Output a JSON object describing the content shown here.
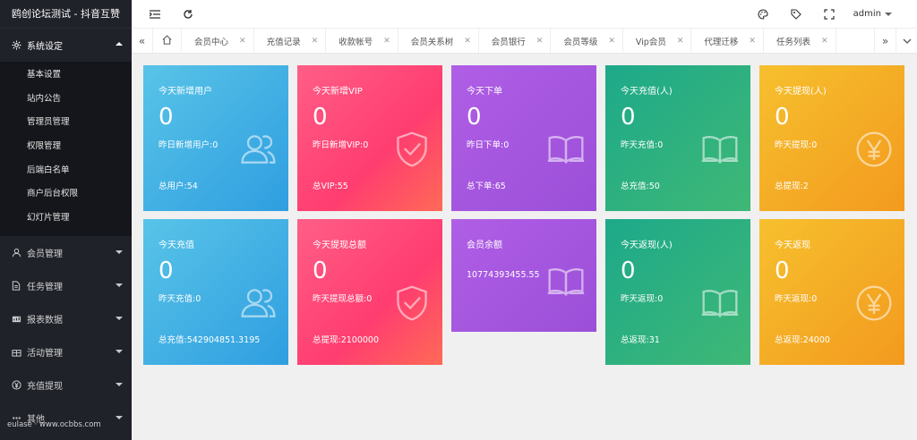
{
  "app": {
    "title": "鸥创论坛测试 - 抖音互赞"
  },
  "header": {
    "user": "admin"
  },
  "sidebar": {
    "groups": [
      {
        "label": "系统设定",
        "icon": "gear-icon",
        "open": true,
        "items": [
          "基本设置",
          "站内公告",
          "管理员管理",
          "权限管理",
          "后端白名单",
          "商户后台权限",
          "幻灯片管理"
        ]
      },
      {
        "label": "会员管理",
        "icon": "user-icon"
      },
      {
        "label": "任务管理",
        "icon": "document-icon"
      },
      {
        "label": "报表数据",
        "icon": "chart-icon"
      },
      {
        "label": "活动管理",
        "icon": "gift-icon"
      },
      {
        "label": "充值提现",
        "icon": "yen-icon"
      },
      {
        "label": "其他",
        "icon": "more-icon"
      }
    ],
    "watermark": "eulase · www.ocbbs.com"
  },
  "tabs": {
    "items": [
      "会员中心",
      "充值记录",
      "收款帐号",
      "会员关系树",
      "会员银行",
      "会员等级",
      "Vip会员",
      "代理迁移",
      "任务列表"
    ]
  },
  "cards": [
    {
      "color": "blue",
      "icon": "users-icon",
      "title": "今天新增用户",
      "value": "0",
      "line": "昨日新增用户:0",
      "foot": "总用户:54"
    },
    {
      "color": "pink",
      "icon": "shield-icon",
      "title": "今天新增VIP",
      "value": "0",
      "line": "昨日新增VIP:0",
      "foot": "总VIP:55"
    },
    {
      "color": "purple",
      "icon": "book-icon",
      "title": "今天下单",
      "value": "0",
      "line": "昨日下单:0",
      "foot": "总下单:65"
    },
    {
      "color": "green",
      "icon": "book-icon",
      "title": "今天充值(人)",
      "value": "0",
      "line": "昨天充值:0",
      "foot": "总充值:50"
    },
    {
      "color": "orange",
      "icon": "yen-icon",
      "title": "今天提现(人)",
      "value": "0",
      "line": "昨天提现:0",
      "foot": "总提现:2"
    },
    {
      "color": "blue",
      "icon": "users-icon",
      "title": "今天充值",
      "value": "0",
      "line": "昨天充值:0",
      "foot": "总充值:542904851.3195"
    },
    {
      "color": "pink",
      "icon": "shield-icon",
      "title": "今天提现总额",
      "value": "0",
      "line": "昨天提现总额:0",
      "foot": "总提现:2100000"
    },
    {
      "color": "purple",
      "icon": "book-icon",
      "title": "会员余额",
      "value": "",
      "line": "10774393455.55",
      "foot": ""
    },
    {
      "color": "green",
      "icon": "book-icon",
      "title": "今天返现(人)",
      "value": "0",
      "line": "昨天返现:0",
      "foot": "总返现:31"
    },
    {
      "color": "orange",
      "icon": "yen-icon",
      "title": "今天返现",
      "value": "0",
      "line": "昨天返现:0",
      "foot": "总返现:24000"
    }
  ]
}
